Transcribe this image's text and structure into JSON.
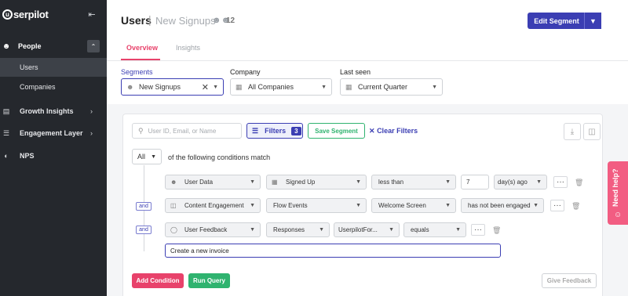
{
  "sidebar": {
    "logo_mark": "u",
    "logo_text": "serpilot",
    "collapse_icon": "collapse-left-icon",
    "people": {
      "label": "People",
      "icon": "users-icon"
    },
    "subitems": [
      {
        "label": "Users",
        "active": true
      },
      {
        "label": "Companies",
        "active": false
      }
    ],
    "items": [
      {
        "label": "Growth Insights",
        "icon": "bar-chart-icon",
        "has_chevron": true
      },
      {
        "label": "Engagement Layer",
        "icon": "layers-icon",
        "has_chevron": true
      },
      {
        "label": "NPS",
        "icon": "gauge-icon",
        "has_chevron": false
      }
    ]
  },
  "header": {
    "title": "Users",
    "separator": "|",
    "segment_name": "New Signups",
    "count": "12",
    "edit_segment_label": "Edit Segment"
  },
  "tabs": [
    {
      "label": "Overview",
      "active": true
    },
    {
      "label": "Insights",
      "active": false
    }
  ],
  "filters": {
    "segments": {
      "label": "Segments",
      "value": "New Signups"
    },
    "company": {
      "label": "Company",
      "value": "All Companies"
    },
    "last_seen": {
      "label": "Last seen",
      "value": "Current Quarter"
    }
  },
  "toolbar": {
    "search_placeholder": "User ID, Email, or Name",
    "filters_label": "Filters",
    "filters_count": "3",
    "save_segment_label": "Save Segment",
    "clear_filters_label": "Clear Filters"
  },
  "query": {
    "match_mode": "All",
    "match_text": "of the following conditions match",
    "connector": "and",
    "conditions": [
      {
        "type": "User Data",
        "field": "Signed Up",
        "operator": "less than",
        "value": "7",
        "unit": "day(s) ago"
      },
      {
        "type": "Content Engagement",
        "field": "Flow Events",
        "target": "Welcome Screen",
        "state": "has not been engaged"
      },
      {
        "type": "User Feedback",
        "field": "Responses",
        "source": "UserpilotFor...",
        "operator": "equals",
        "text_value": "Create a new invoice"
      }
    ]
  },
  "actions": {
    "add_condition": "Add Condition",
    "run_query": "Run Query",
    "give_feedback": "Give Feedback"
  },
  "help": {
    "label": "Need help?"
  },
  "colors": {
    "sidebar_bg": "#25282d",
    "primary": "#3b3eb3",
    "accent_pink": "#e8426b",
    "green": "#2fb36f",
    "help_pink": "#f25d82"
  }
}
